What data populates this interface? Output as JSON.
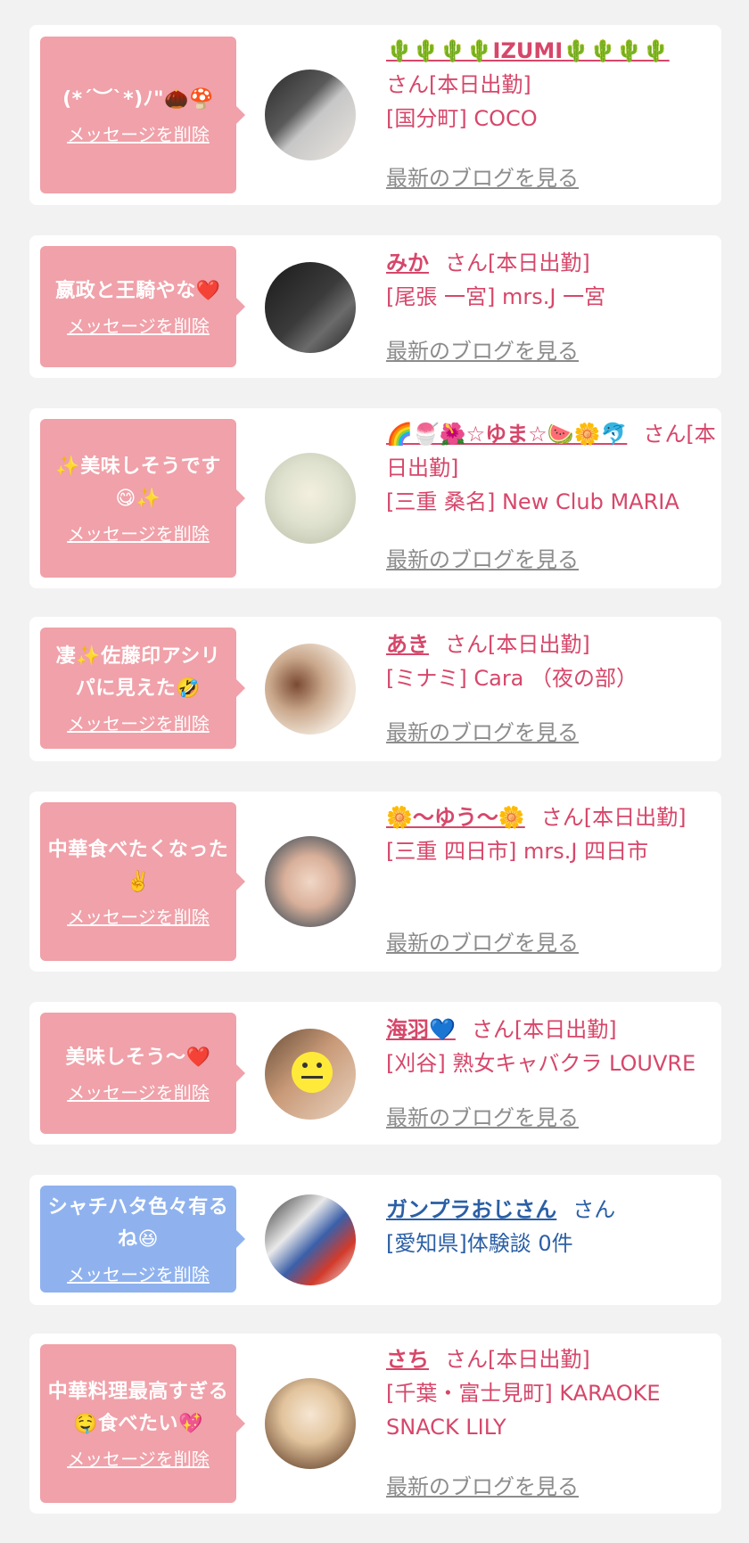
{
  "delete_label": "メッセージを削除",
  "blog_label": "最新のブログを見る",
  "colors": {
    "pink": "#f0a1a9",
    "blue": "#8fb2ef",
    "name_pink": "#d6476a",
    "name_blue": "#2b5fa6",
    "gray": "#8c8c8c"
  },
  "cards": [
    {
      "message": "(*´︶`*)ﾉ\"🌰🍄",
      "name": "🌵🌵🌵🌵IZUMI🌵🌵🌵🌵",
      "san": "さん[本日出勤]",
      "shop": "[国分町] COCO"
    },
    {
      "message": "嬴政と王騎やな❤️",
      "name": "みか",
      "san": "さん[本日出勤]",
      "shop": "[尾張 一宮] mrs.J 一宮"
    },
    {
      "message": "✨美味しそうです😋✨",
      "name": "🌈🍧🌺☆ゆま☆🍉🌼🐬",
      "san": "さん[本日出勤]",
      "shop": "[三重 桑名] New Club MARIA"
    },
    {
      "message": "凄✨佐藤印アシリパに見えた🤣",
      "name": "あき",
      "san": "さん[本日出勤]",
      "shop": "[ミナミ] Cara （夜の部）"
    },
    {
      "message": "中華食べたくなった✌️",
      "name": "🌼〜ゆう〜🌼",
      "san": "さん[本日出勤]",
      "shop": "[三重 四日市] mrs.J 四日市"
    },
    {
      "message": "美味しそう〜❤️",
      "name": "海羽💙",
      "san": "さん[本日出勤]",
      "shop": "[刈谷] 熟女キャバクラ LOUVRE"
    },
    {
      "message": "シャチハタ色々有るね😆",
      "name": "ガンプラおじさん",
      "san": "さん",
      "shop": "[愛知県]体験談 0件"
    },
    {
      "message": "中華料理最高すぎる🤤食べたい💖",
      "name": "さち",
      "san": "さん[本日出勤]",
      "shop": "[千葉・富士見町] KARAOKE SNACK LILY"
    }
  ]
}
